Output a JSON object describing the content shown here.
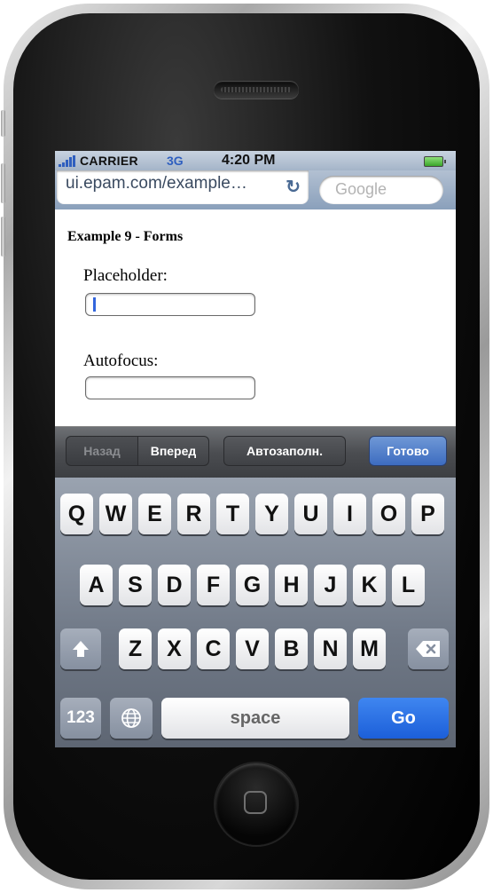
{
  "status_bar": {
    "carrier": "CARRIER",
    "network": "3G",
    "time": "4:20 PM"
  },
  "browser": {
    "url": "ui.epam.com/example…",
    "search_placeholder": "Google"
  },
  "page": {
    "title": "Example 9 - Forms",
    "fields": [
      {
        "label": "Placeholder:",
        "value": ""
      },
      {
        "label": "Autofocus:",
        "value": ""
      }
    ]
  },
  "form_toolbar": {
    "prev": "Назад",
    "next": "Вперед",
    "autofill": "Автозаполн.",
    "done": "Готово"
  },
  "keyboard": {
    "row1": [
      "Q",
      "W",
      "E",
      "R",
      "T",
      "Y",
      "U",
      "I",
      "O",
      "P"
    ],
    "row2": [
      "A",
      "S",
      "D",
      "F",
      "G",
      "H",
      "J",
      "K",
      "L"
    ],
    "row3": [
      "Z",
      "X",
      "C",
      "V",
      "B",
      "N",
      "M"
    ],
    "numbers": "123",
    "space": "space",
    "go": "Go",
    "icons": {
      "shift": "shift-icon",
      "delete": "backspace-icon",
      "globe": "globe-icon"
    }
  },
  "colors": {
    "go_key": "#1c5fd9",
    "done_button": "#3d6cc0",
    "caret": "#3366dd"
  }
}
